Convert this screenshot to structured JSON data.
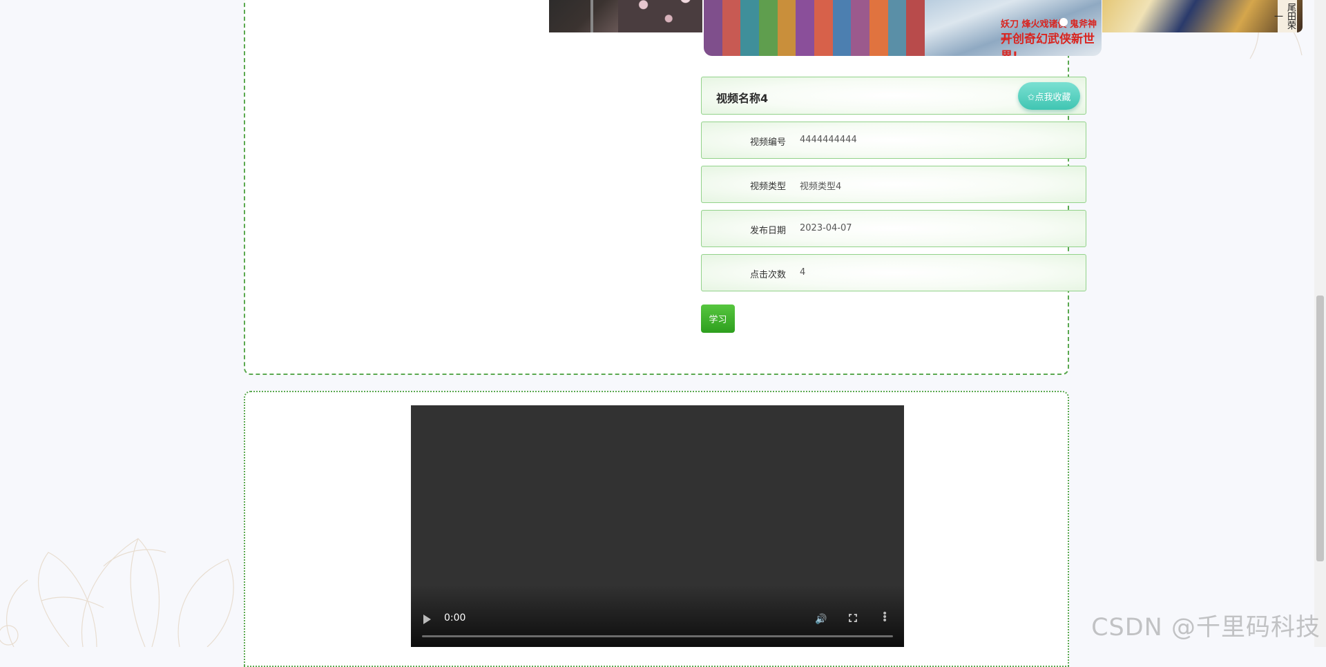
{
  "video_info": {
    "title": "视频名称4",
    "favorite_label": "✩点我收藏",
    "rows": [
      {
        "label": "视频编号",
        "value": "4444444444"
      },
      {
        "label": "视频类型",
        "value": "视频类型4"
      },
      {
        "label": "发布日期",
        "value": "2023-04-07"
      },
      {
        "label": "点击次数",
        "value": "4"
      }
    ],
    "study_label": "学习"
  },
  "carousel": {
    "center_caption_1": "妖刀 烽火戏诸侯 鬼斧神工",
    "center_caption_2": "开创奇幻武侠新世界!",
    "right_caption": "尾田荣一"
  },
  "player": {
    "time": "0:00"
  },
  "watermark": "CSDN @千里码科技",
  "colors": {
    "border": "#5aa84f",
    "favorite_button": "#40c5b2",
    "study_button": "#2e9f1e"
  }
}
